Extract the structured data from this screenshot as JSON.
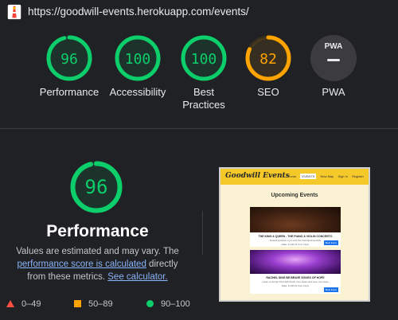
{
  "colors": {
    "pass": "#0cce6b",
    "average": "#ffa400",
    "fail": "#ff4e42",
    "link": "#8ab4f8",
    "background": "#202124"
  },
  "header": {
    "logo_icon": "lighthouse-icon",
    "url": "https://goodwill-events.herokuapp.com/events/"
  },
  "summary": [
    {
      "label": "Performance",
      "score": 96,
      "rating": "pass"
    },
    {
      "label": "Accessibility",
      "score": 100,
      "rating": "pass"
    },
    {
      "label": "Best Practices",
      "score": 100,
      "rating": "pass"
    },
    {
      "label": "SEO",
      "score": 82,
      "rating": "average"
    },
    {
      "label": "PWA",
      "badge": "PWA",
      "icon": "pwa-badge-icon"
    }
  ],
  "detail": {
    "score": 96,
    "title": "Performance",
    "desc_before": "Values are estimated and may vary. The ",
    "link1": "performance score is calculated",
    "desc_middle": " directly from these metrics. ",
    "link2": "See calculator."
  },
  "legend": [
    {
      "range": "0–49",
      "icon": "triangle-icon"
    },
    {
      "range": "50–89",
      "icon": "square-icon"
    },
    {
      "range": "90–100",
      "icon": "circle-icon"
    }
  ],
  "screenshot": {
    "logo": "Goodwill Events",
    "nav": [
      "Home",
      "EVENTS",
      "New Map",
      "Sign In",
      "Register"
    ],
    "heading": "Upcoming Events",
    "events": [
      {
        "title": "THE KING & QUEEN - THE PIANO & VIOLIN CONCERTO",
        "subtitle": "Featuring Alison Lyon and the Friends Ensemble",
        "date": "Date: 21.06.21 from 11pm",
        "button": "Book Event"
      },
      {
        "title": "RACHEL SING BE BRAVE SONGS OF HOPE",
        "subtitle": "Listen to Songs That Will Touch Your Heart and Give You Hope",
        "date": "Date: 11.06.21 from 11pm",
        "button": "Book Event"
      }
    ]
  }
}
